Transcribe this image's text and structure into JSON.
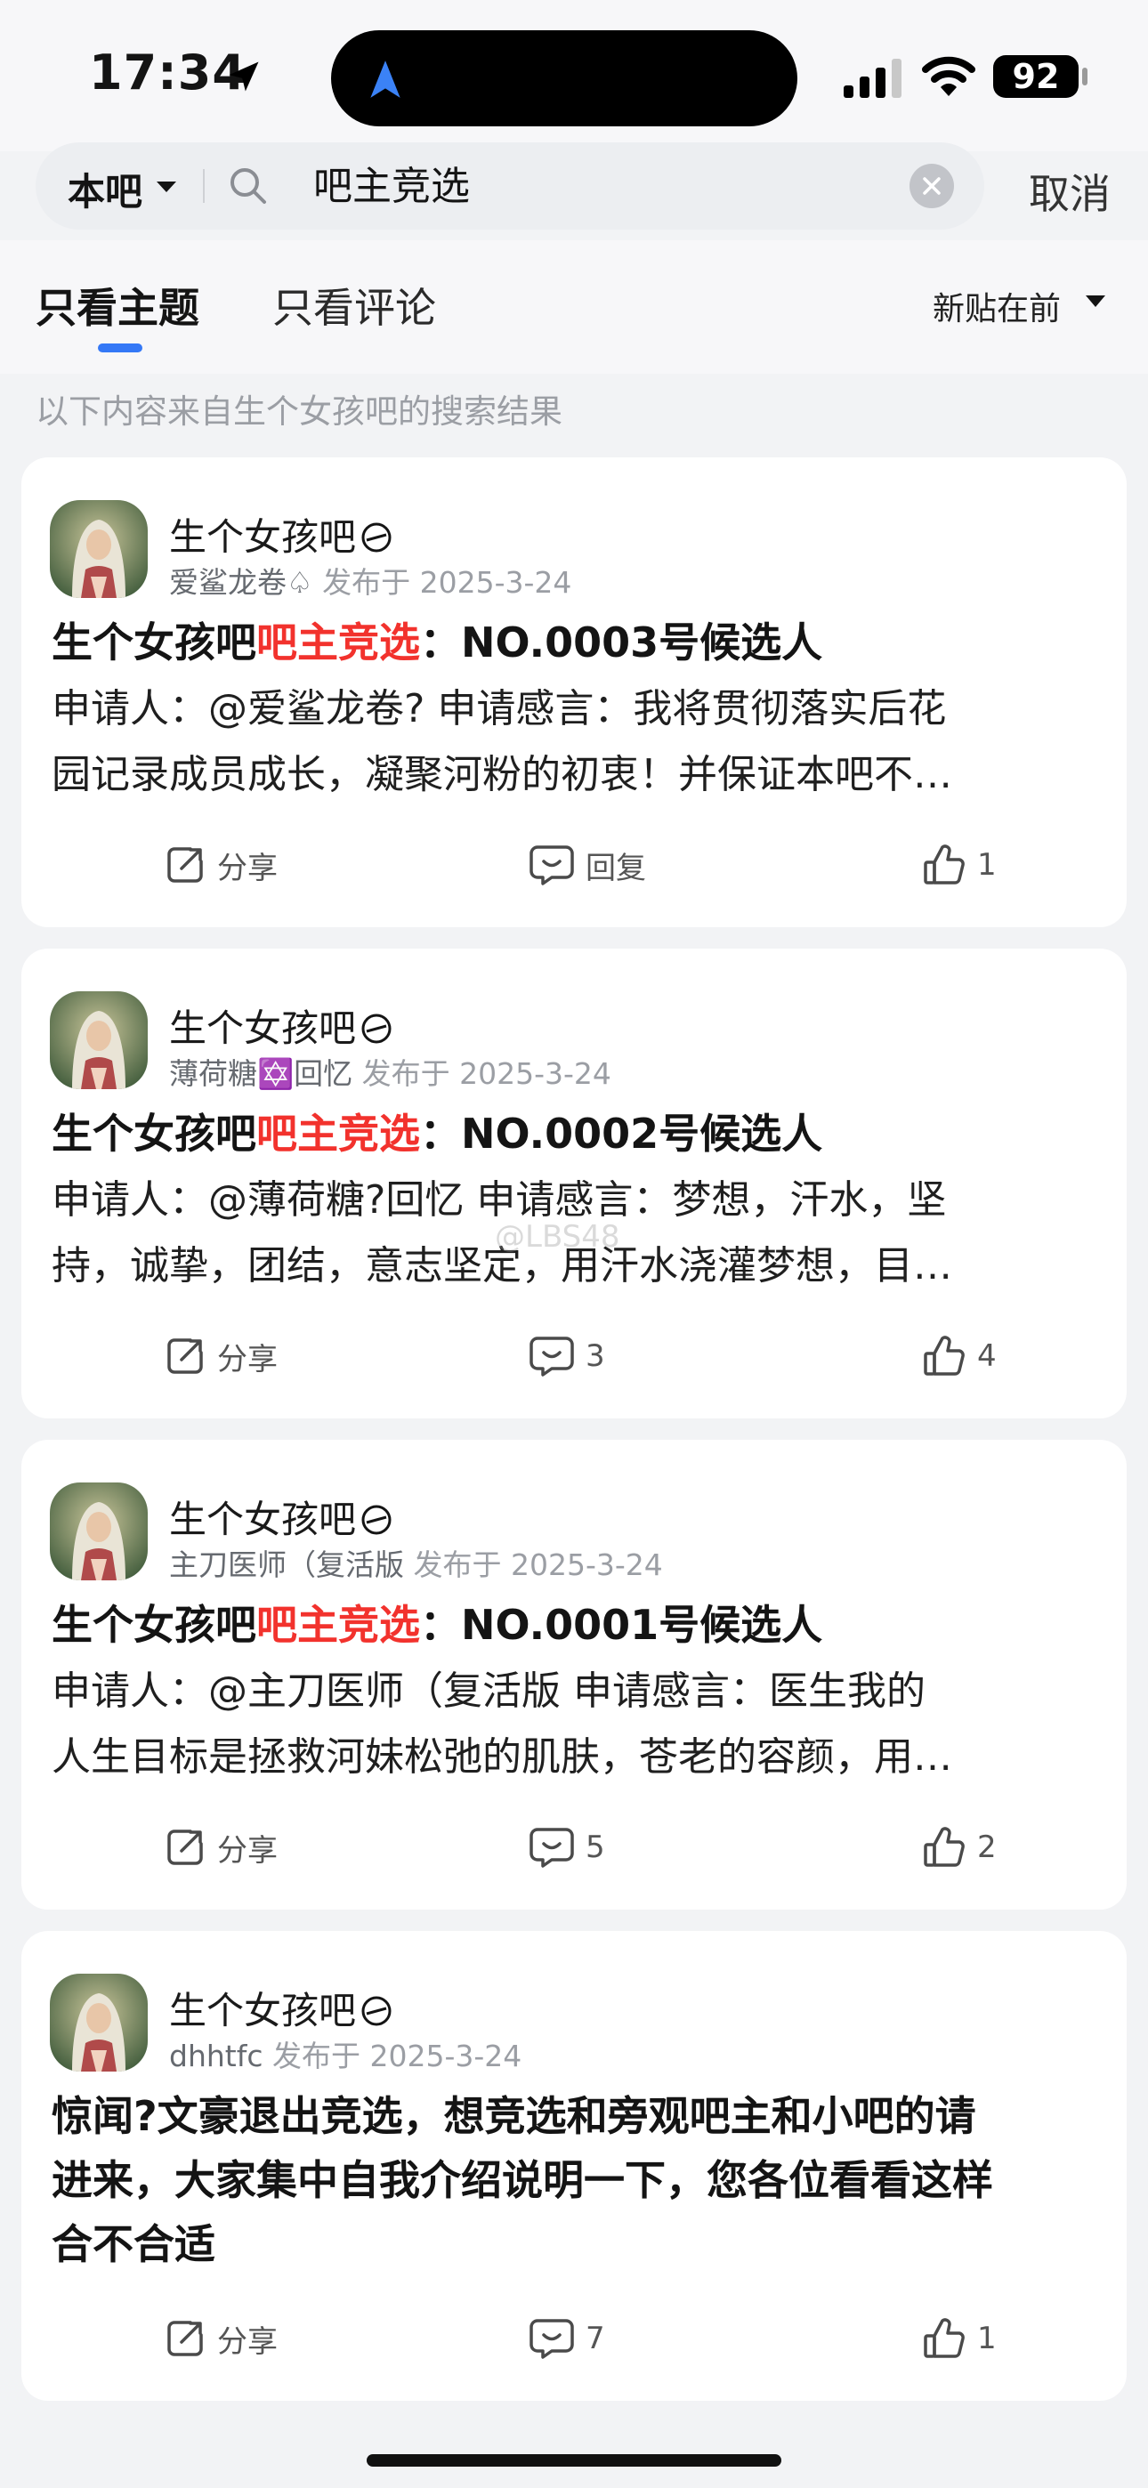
{
  "status_bar": {
    "time": "17:34",
    "battery": "92",
    "icons": [
      "location-arrow-icon",
      "signal-icon",
      "wifi-icon",
      "battery-icon"
    ]
  },
  "search": {
    "scope": "本吧",
    "query": "吧主竞选",
    "cancel": "取消"
  },
  "tabs": {
    "items": [
      "只看主题",
      "只看评论"
    ],
    "active": "只看主题",
    "sort": "新贴在前"
  },
  "result_note": "以下内容来自生个女孩吧的搜索结果",
  "posts": [
    {
      "forum": "生个女孩吧",
      "author": "爱鲨龙卷♤",
      "posted": "发布于 2025-3-24",
      "title_prefix": "生个女孩吧",
      "title_highlight": "吧主竞选",
      "title_suffix": "：NO.0003号候选人",
      "body_line1": "申请人：@爱鲨龙卷? 申请感言：我将贯彻落实后花",
      "body_line2": "园记录成员成长，凝聚河粉的初衷！并保证本吧不…",
      "share": "分享",
      "reply": "回复",
      "likes": "1"
    },
    {
      "forum": "生个女孩吧",
      "author": "薄荷糖✡️回忆",
      "posted": "发布于 2025-3-24",
      "title_prefix": "生个女孩吧",
      "title_highlight": "吧主竞选",
      "title_suffix": "：NO.0002号候选人",
      "body_line1": "申请人：@薄荷糖?回忆 申请感言：梦想，汗水，坚",
      "body_line2": "持，诚挚，团结，意志坚定，用汗水浇灌梦想，目…",
      "share": "分享",
      "reply": "3",
      "likes": "4"
    },
    {
      "forum": "生个女孩吧",
      "author": "主刀医师（复活版",
      "posted": "发布于 2025-3-24",
      "title_prefix": "生个女孩吧",
      "title_highlight": "吧主竞选",
      "title_suffix": "：NO.0001号候选人",
      "body_line1": "申请人：@主刀医师（复活版 申请感言：医生我的",
      "body_line2": "人生目标是拯救河妹松弛的肌肤，苍老的容颜，用…",
      "share": "分享",
      "reply": "5",
      "likes": "2"
    },
    {
      "forum": "生个女孩吧",
      "author": "dhhtfc",
      "posted": "发布于 2025-3-24",
      "title_line1": "惊闻?文豪退出竞选，想竞选和旁观吧主和小吧的请",
      "title_line2": "进来，大家集中自我介绍说明一下，您各位看看这样",
      "title_line3": "合不合适",
      "share": "分享",
      "reply": "7",
      "likes": "1"
    }
  ],
  "watermark": "@LBS48",
  "colors": {
    "accent": "#3478f6",
    "highlight": "#f2322d",
    "background": "#f2f3f5"
  }
}
